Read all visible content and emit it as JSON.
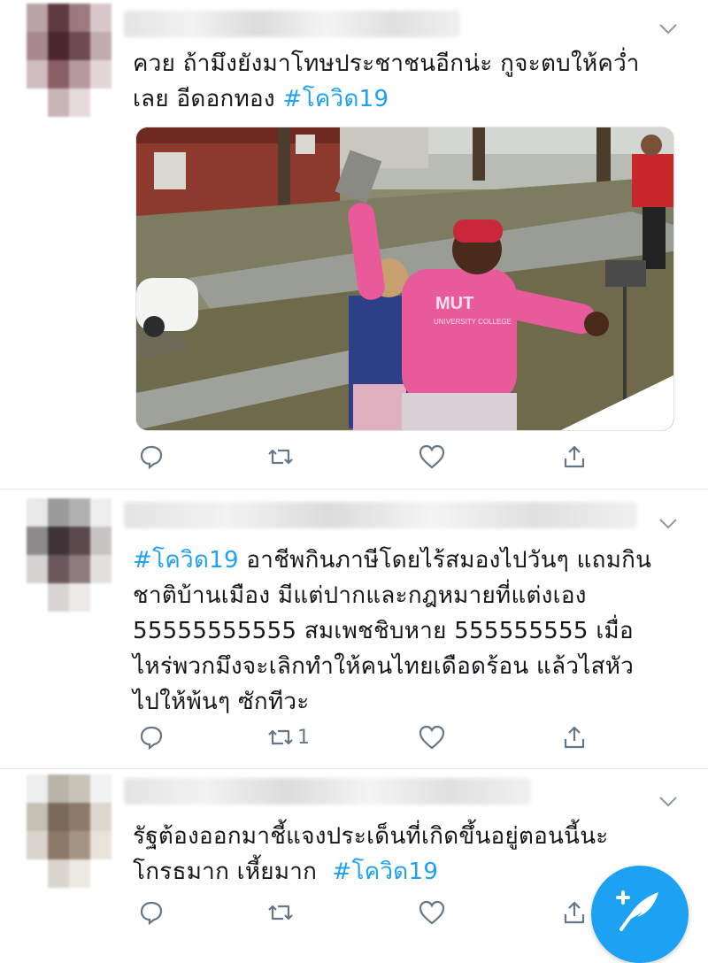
{
  "tweets": [
    {
      "segments": [
        {
          "text": "ควย ถ้ามึงยังมาโทษประชาชนอีกน่ะ กูจะตบให้คว่ำ\nเลย อีดอกทอง ",
          "hashtag": false
        },
        {
          "text": "#โควิด19",
          "hashtag": true
        }
      ],
      "media": {
        "caption": "MUT",
        "subcaption": "UNIVERSITY COLLEGE"
      },
      "actions": {
        "reply": "",
        "retweet": "",
        "like": "",
        "share": ""
      }
    },
    {
      "segments": [
        {
          "text": "#โควิด19",
          "hashtag": true
        },
        {
          "text": " อาชีพกินภาษีโดยไร้สมองไปวันๆ แถมกิน\nชาติบ้านเมือง มีแต่ปากและกฎหมายที่แต่งเอง\n55555555555 สมเพชชิบหาย 555555555 เมื่อ\nไหร่พวกมึงจะเลิกทำให้คนไทยเดือดร้อน แล้วไสหัว\nไปให้พ้นๆ ซักทีวะ",
          "hashtag": false
        }
      ],
      "actions": {
        "reply": "",
        "retweet": "1",
        "like": "",
        "share": ""
      }
    },
    {
      "segments": [
        {
          "text": "รัฐต้องออกมาชี้แจงประเด็นที่เกิดขึ้นอยู่ตอนนี้นะ\nโกรธมาก เหี้ยมาก  ",
          "hashtag": false
        },
        {
          "text": "#โควิด19",
          "hashtag": true
        }
      ],
      "actions": {
        "reply": "",
        "retweet": "",
        "like": "",
        "share": ""
      }
    }
  ],
  "icons": {
    "reply": "reply-icon",
    "retweet": "retweet-icon",
    "like": "heart-icon",
    "share": "share-icon",
    "more": "chevron-down-icon",
    "compose": "compose-tweet-icon"
  },
  "colors": {
    "link": "#1da1f2",
    "icon": "#657786",
    "divider": "#e1e8ed",
    "fab": "#1da1f2"
  }
}
